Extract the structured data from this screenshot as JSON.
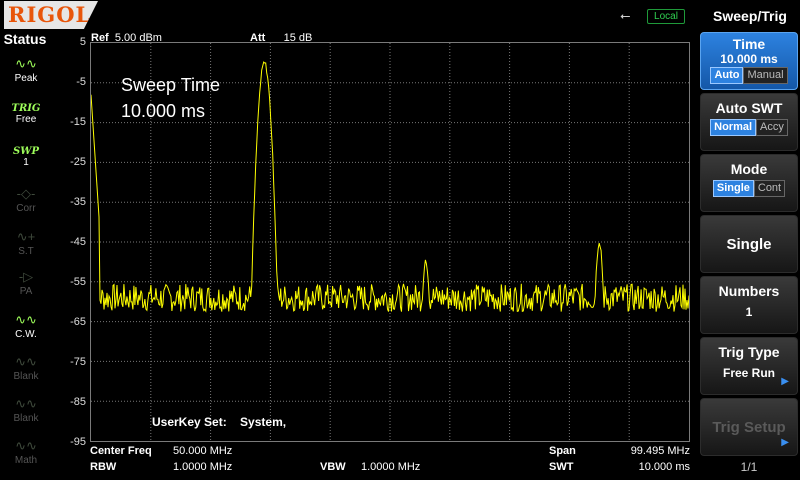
{
  "topbar": {
    "logo": "RIGOL",
    "usb_icon": "usb-icon",
    "local_label": "Local"
  },
  "status": {
    "title": "Status",
    "items": [
      {
        "icon": "peak-wave-icon",
        "label": "Peak",
        "state": "on"
      },
      {
        "icon": "TRIG",
        "label": "Free",
        "state": "on"
      },
      {
        "icon": "SWP",
        "label": "1",
        "state": "on"
      },
      {
        "icon": "corr-icon",
        "label": "Corr",
        "state": "off"
      },
      {
        "icon": "st-icon",
        "label": "S.T",
        "state": "off"
      },
      {
        "icon": "pa-icon",
        "label": "PA",
        "state": "off"
      },
      {
        "icon": "cw-icon",
        "label": "C.W.",
        "state": "on"
      },
      {
        "icon": "blank-icon",
        "label": "Blank",
        "state": "off"
      },
      {
        "icon": "blank-icon",
        "label": "Blank",
        "state": "off"
      },
      {
        "icon": "math-icon",
        "label": "Math",
        "state": "off"
      }
    ]
  },
  "plot": {
    "ref_label": "Ref",
    "ref_value": "5.00 dBm",
    "att_label": "Att",
    "att_value": "15 dB",
    "y_ticks": [
      "5",
      "-5",
      "-15",
      "-25",
      "-35",
      "-45",
      "-55",
      "-65",
      "-75",
      "-85",
      "-95"
    ],
    "overlay_label": "Sweep Time",
    "overlay_value": "10.000 ms",
    "userkey_label": "UserKey Set:",
    "userkey_value": "System,",
    "trace_color": "#ffff00",
    "chart_data": {
      "type": "line",
      "ylim": [
        -95,
        5
      ],
      "y_unit": "dBm",
      "peaks": [
        {
          "x_frac": 0.29,
          "y": 0
        },
        {
          "x_frac": 0.56,
          "y": -50
        },
        {
          "x_frac": 0.85,
          "y": -45
        }
      ],
      "noise_floor": -59
    }
  },
  "bottom": {
    "center_label": "Center Freq",
    "center_value": "50.000 MHz",
    "rbw_label": "RBW",
    "rbw_value": "1.0000 MHz",
    "vbw_label": "VBW",
    "vbw_value": "1.0000 MHz",
    "span_label": "Span",
    "span_value": "99.495 MHz",
    "swt_label": "SWT",
    "swt_value": "10.000 ms"
  },
  "menu": {
    "title": "Sweep/Trig",
    "time": {
      "label": "Time",
      "value": "10.000 ms",
      "opt_a": "Auto",
      "opt_b": "Manual",
      "selected": "Auto"
    },
    "auto_swt": {
      "label": "Auto SWT",
      "opt_a": "Normal",
      "opt_b": "Accy",
      "selected": "Normal"
    },
    "mode": {
      "label": "Mode",
      "opt_a": "Single",
      "opt_b": "Cont",
      "selected": "Single"
    },
    "single": {
      "label": "Single"
    },
    "numbers": {
      "label": "Numbers",
      "value": "1"
    },
    "trig_type": {
      "label": "Trig Type",
      "value": "Free Run"
    },
    "trig_setup": {
      "label": "Trig Setup"
    },
    "page": "1/1"
  }
}
